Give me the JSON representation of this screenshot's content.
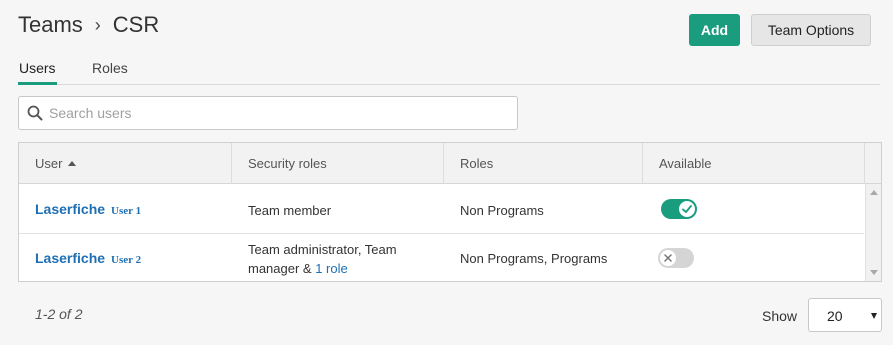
{
  "breadcrumb": {
    "root": "Teams",
    "separator": "›",
    "current": "CSR"
  },
  "actions": {
    "add_label": "Add",
    "options_label": "Team Options"
  },
  "tabs": [
    {
      "label": "Users",
      "active": true
    },
    {
      "label": "Roles",
      "active": false
    }
  ],
  "search": {
    "placeholder": "Search users",
    "value": ""
  },
  "table": {
    "columns": [
      "User",
      "Security roles",
      "Roles",
      "Available"
    ],
    "sort_column": "User",
    "sort_direction": "ascending",
    "rows": [
      {
        "user": "Laserfiche",
        "user_tag": "User 1",
        "security_roles": "Team member",
        "security_roles_more": "",
        "roles": "Non Programs",
        "available": true
      },
      {
        "user": "Laserfiche",
        "user_tag": "User 2",
        "security_roles": "Team administrator, Team manager & ",
        "security_roles_more": "1 role",
        "roles": "Non Programs, Programs",
        "available": false
      }
    ]
  },
  "footer": {
    "paging": "1-2 of 2",
    "show_label": "Show",
    "page_size": "20"
  },
  "colors": {
    "accent": "#1a9c7f",
    "link": "#1f6fb4"
  }
}
